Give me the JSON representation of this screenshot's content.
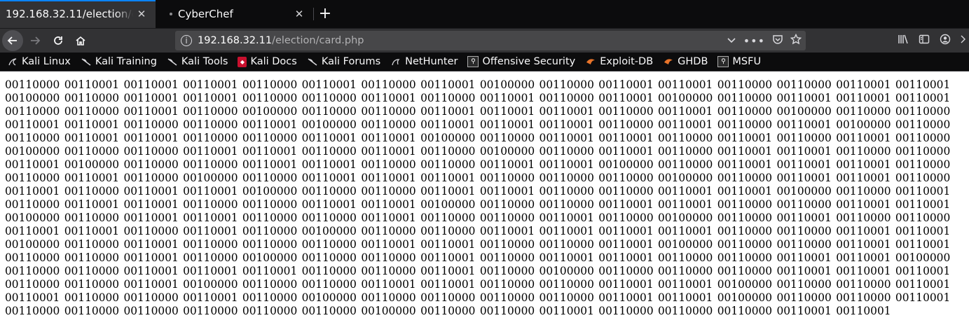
{
  "tabs": [
    {
      "label": "192.168.32.11/election/card.php",
      "active": true
    },
    {
      "label": "CyberChef",
      "active": false
    }
  ],
  "url": {
    "host": "192.168.32.11",
    "path": "/election/card.php"
  },
  "bookmarks": [
    {
      "label": "Kali Linux",
      "icon": "kali-dragon-icon"
    },
    {
      "label": "Kali Training",
      "icon": "kali-dragon-icon"
    },
    {
      "label": "Kali Tools",
      "icon": "kali-dragon-icon"
    },
    {
      "label": "Kali Docs",
      "icon": "kali-docs-icon"
    },
    {
      "label": "Kali Forums",
      "icon": "kali-dragon-icon"
    },
    {
      "label": "NetHunter",
      "icon": "nethunter-icon"
    },
    {
      "label": "Offensive Security",
      "icon": "offsec-icon"
    },
    {
      "label": "Exploit-DB",
      "icon": "exploitdb-icon"
    },
    {
      "label": "GHDB",
      "icon": "exploitdb-icon"
    },
    {
      "label": "MSFU",
      "icon": "offsec-icon"
    }
  ],
  "page_content": "00110000 00110001 00110001 00110001 00110000 00110001 00110000 00110001 00100000 00110000 00110001 00110001 00110000 00110000 00110001 00110001 00100000 00110000 00110001 00110001 00110000 00110000 00110001 00110000 00110001 00110000 00110001 00100000 00110000 00110001 00110001 00110001 00110000 00110000 00110001 00110000 00100000 00110000 00110000 00110001 00110001 00110001 00110000 00110001 00110000 00100000 00110000 00110000 00110001 00110001 00110000 00110000 00110001 00100000 00110000 00110001 00110001 00110001 00110000 00110001 00110000 00110001 00100000 00110000 00110000 00110001 00110001 00110000 00110000 00110001 00110001 00100000 00110000 00110001 00110001 00110000 00110001 00110000 00110001 00110000 00100000 00110000 00110000 00110001 00110001 00110000 00110001 00110000 00100000 00110000 00110001 00110000 00110001 00110001 00110000 00110000 00110001 00100000 00110000 00110000 00110001 00110001 00110000 00110000 00110001 00110001 00100000 00110000 00110001 00110001 00110001 00110000 00110000 00110001 00110000 00100000 00110000 00110001 00110001 00110001 00110000 00110000 00110000 00100000 00110000 00110001 00110001 00110000 00110001 00110000 00110001 00110001 00100000 00110000 00110000 00110001 00110001 00110000 00110000 00110001 00110001 00100000 00110000 00110001 00110000 00110001 00110001 00110000 00110000 00110001 00110001 00100000 00110000 00110000 00110001 00110001 00110000 00110000 00110001 00110001 00100000 00110000 00110001 00110001 00110000 00110000 00110001 00110000 00110000 00110001 00110000 00100000 00110000 00110001 00110000 00110000 00110001 00110001 00110000 00110001 00110000 00100000 00110000 00110000 00110001 00110001 00110001 00110001 00110000 00110000 00110001 00110001 00100000 00110000 00110001 00110000 00110000 00110000 00110001 00110001 00110000 00110000 00110001 00100000 00110000 00110000 00110001 00110001 00110000 00110000 00110001 00110000 00100000 00110000 00110000 00110001 00110000 00110001 00110001 00110000 00110000 00110001 00110001 00100000 00110000 00110000 00110001 00110001 00110001 00110000 00110000 00110001 00110000 00100000 00110000 00110000 00110000 00110001 00110001 00110001 00110000 00110000 00110001 00100000 00110000 00110000 00110001 00110001 00110000 00110000 00110001 00110001 00100000 00110000 00110000 00110001 00110001 00110000 00110000 00110001 00110000 00100000 00110000 00110000 00110000 00110000 00110001 00110001 00100000 00110000 00110000 00110001 00110000 00110000 00110000 00110000 00110000 00110000 00100000 00110000 00110000 00110001 00110000 00110000 00110000 00110001 00110001"
}
